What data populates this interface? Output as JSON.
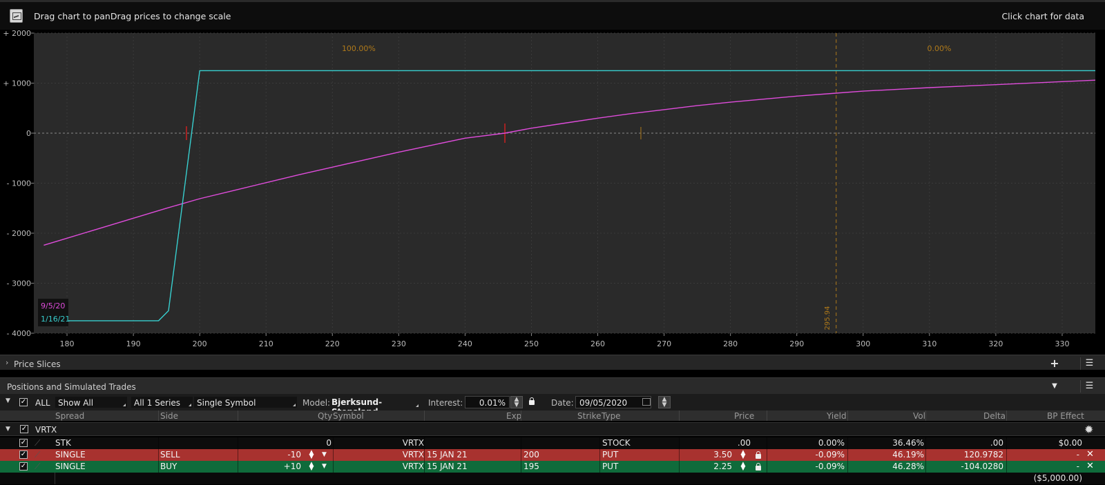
{
  "header": {
    "hint_left": "Drag chart to panDrag prices to change scale",
    "hint_right": "Click chart for data"
  },
  "chart_data": {
    "type": "line",
    "xlim": [
      175,
      335
    ],
    "ylim": [
      -4000,
      2000
    ],
    "x_ticks": [
      180,
      190,
      200,
      210,
      220,
      230,
      240,
      250,
      260,
      270,
      280,
      290,
      300,
      310,
      320,
      330
    ],
    "y_ticks": [
      2000,
      1000,
      0,
      -1000,
      -2000,
      -3000,
      -4000
    ],
    "y_tick_labels": [
      "+ 2000",
      "+ 1000",
      "0",
      "- 1000",
      "- 2000",
      "- 3000",
      "- 4000"
    ],
    "prob_labels": {
      "left": "100.00%",
      "right": "0.00%"
    },
    "marker_line": {
      "x": 295.94,
      "label": "295.94"
    },
    "current_price_x": 266.5,
    "breakeven_x": 246,
    "series": [
      {
        "name": "9/5/20",
        "color": "#e04cdc",
        "x": [
          176.5,
          180,
          185,
          190,
          195,
          200,
          205,
          210,
          215,
          220,
          225,
          230,
          235,
          240,
          246,
          250,
          255,
          260,
          265,
          270,
          275,
          280,
          285,
          290,
          295.94,
          300,
          310,
          320,
          330,
          335
        ],
        "y": [
          -2240,
          -2100,
          -1900,
          -1700,
          -1500,
          -1310,
          -1150,
          -990,
          -830,
          -680,
          -530,
          -380,
          -240,
          -100,
          0,
          100,
          200,
          300,
          390,
          470,
          550,
          620,
          680,
          740,
          800,
          840,
          910,
          970,
          1030,
          1060
        ]
      },
      {
        "name": "1/16/21",
        "color": "#38d0d0",
        "x": [
          176.5,
          193.8,
          195.3,
          200,
          335
        ],
        "y": [
          -3750,
          -3750,
          -3550,
          1250,
          1250
        ]
      }
    ]
  },
  "panels": {
    "price_slices": "Price Slices",
    "positions": "Positions and Simulated Trades"
  },
  "controls": {
    "all_label": "ALL",
    "show": "Show All",
    "series": "All 1 Series",
    "symbol_mode": "Single Symbol",
    "model_label": "Model:",
    "model_value": "Bjerksund-Stensland",
    "interest_label": "Interest:",
    "interest_value": "0.01%",
    "date_label": "Date:",
    "date_value": "09/05/2020"
  },
  "table": {
    "headers": {
      "spread": "Spread",
      "side": "Side",
      "qty": "Qty",
      "symbol": "Symbol",
      "exp": "Exp",
      "strike": "Strike",
      "type": "Type",
      "price": "Price",
      "yield": "Yield",
      "vol": "Vol",
      "delta": "Delta",
      "bp_effect": "BP Effect"
    },
    "group_symbol": "VRTX",
    "rows": [
      {
        "spread": "STK",
        "side": "",
        "qty": "0",
        "symbol": "VRTX",
        "exp": "",
        "strike": "",
        "type": "STOCK",
        "price": ".00",
        "yield": "0.00%",
        "vol": "36.46%",
        "delta": ".00",
        "bp": "$0.00"
      },
      {
        "spread": "SINGLE",
        "side": "SELL",
        "qty": "-10",
        "symbol": "VRTX",
        "exp": "15 JAN 21",
        "strike": "200",
        "type": "PUT",
        "price": "3.50",
        "yield": "-0.09%",
        "vol": "46.19%",
        "delta": "120.9782",
        "bp": "-"
      },
      {
        "spread": "SINGLE",
        "side": "BUY",
        "qty": "+10",
        "symbol": "VRTX",
        "exp": "15 JAN 21",
        "strike": "195",
        "type": "PUT",
        "price": "2.25",
        "yield": "-0.09%",
        "vol": "46.28%",
        "delta": "-104.0280",
        "bp": "-"
      }
    ],
    "total_bp": "($5,000.00)"
  }
}
